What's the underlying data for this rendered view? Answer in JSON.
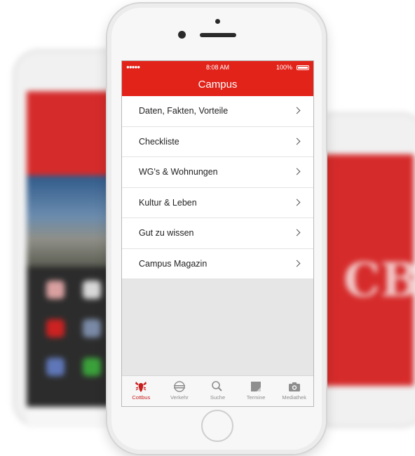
{
  "status_bar": {
    "signal": "●●●●●",
    "time": "8:08 AM",
    "battery": "100%"
  },
  "header": {
    "title": "Campus"
  },
  "menu": {
    "items": [
      {
        "label": "Daten, Fakten, Vorteile"
      },
      {
        "label": "Checkliste"
      },
      {
        "label": "WG's & Wohnungen"
      },
      {
        "label": "Kultur & Leben"
      },
      {
        "label": "Gut zu wissen"
      },
      {
        "label": "Campus Magazin"
      }
    ]
  },
  "tabbar": {
    "tabs": [
      {
        "label": "Cottbus",
        "icon": "lobster-icon",
        "active": true
      },
      {
        "label": "Verkehr",
        "icon": "train-icon"
      },
      {
        "label": "Suche",
        "icon": "search-icon"
      },
      {
        "label": "Termine",
        "icon": "calendar-icon"
      },
      {
        "label": "Mediathek",
        "icon": "camera-icon"
      }
    ]
  },
  "background_logo": "CB",
  "colors": {
    "accent": "#e2231a",
    "active_tab": "#c81e1e",
    "inactive_tab": "#8e8e8e"
  }
}
